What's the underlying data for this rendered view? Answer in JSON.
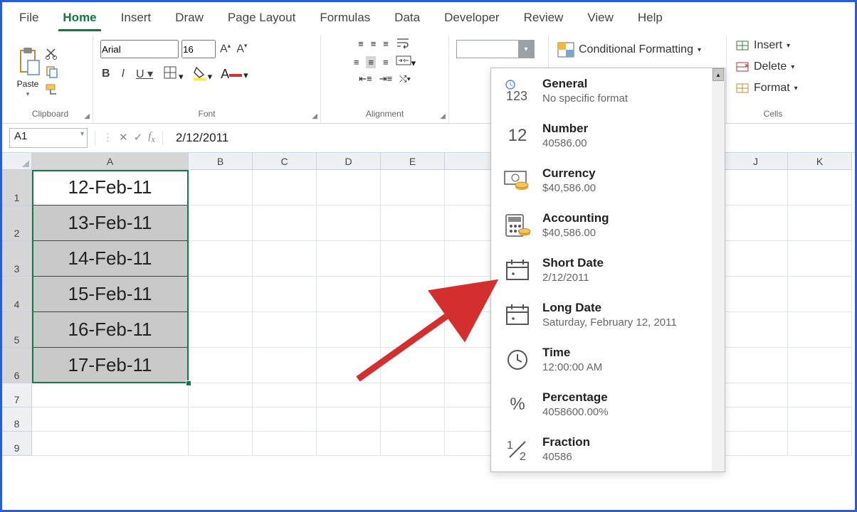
{
  "tabs": [
    "File",
    "Home",
    "Insert",
    "Draw",
    "Page Layout",
    "Formulas",
    "Data",
    "Developer",
    "Review",
    "View",
    "Help"
  ],
  "activeTab": "Home",
  "clipboard": {
    "paste": "Paste",
    "label": "Clipboard"
  },
  "font": {
    "name": "Arial",
    "size": "16",
    "label": "Font"
  },
  "alignment": {
    "label": "Alignment"
  },
  "styles": {
    "condfmt": "Conditional Formatting"
  },
  "cells": {
    "insert": "Insert",
    "delete": "Delete",
    "format": "Format",
    "label": "Cells"
  },
  "nameBox": "A1",
  "formula": "2/12/2011",
  "columns": [
    "A",
    "B",
    "C",
    "D",
    "E",
    "J",
    "K"
  ],
  "rowData": [
    "12-Feb-11",
    "13-Feb-11",
    "14-Feb-11",
    "15-Feb-11",
    "16-Feb-11",
    "17-Feb-11"
  ],
  "emptyRows": [
    7,
    8,
    9
  ],
  "numberFormats": [
    {
      "name": "General",
      "sample": "No specific format",
      "icon": "123clock"
    },
    {
      "name": "Number",
      "sample": "40586.00",
      "icon": "12"
    },
    {
      "name": "Currency",
      "sample": "$40,586.00",
      "icon": "currency"
    },
    {
      "name": "Accounting",
      "sample": " $40,586.00",
      "icon": "accounting"
    },
    {
      "name": "Short Date",
      "sample": "2/12/2011",
      "icon": "cal-dot"
    },
    {
      "name": "Long Date",
      "sample": "Saturday, February 12, 2011",
      "icon": "cal-dot"
    },
    {
      "name": "Time",
      "sample": "12:00:00 AM",
      "icon": "clock"
    },
    {
      "name": "Percentage",
      "sample": "4058600.00%",
      "icon": "percent"
    },
    {
      "name": "Fraction",
      "sample": "40586",
      "icon": "fraction"
    }
  ]
}
